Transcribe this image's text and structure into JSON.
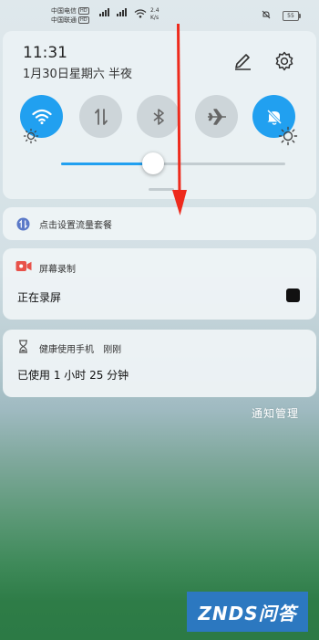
{
  "status_bar": {
    "carrier1": "中国电信",
    "carrier2": "中国联通",
    "hd_badge": "HD",
    "speed_value": "2.4",
    "speed_unit": "K/s",
    "battery": "55"
  },
  "quick_settings": {
    "time": "11:31",
    "date": "1月30日星期六 半夜",
    "toggles": [
      {
        "name": "wifi",
        "icon": "wifi-icon",
        "on": true
      },
      {
        "name": "mobile-data",
        "icon": "data-arrows-icon",
        "on": false
      },
      {
        "name": "bluetooth",
        "icon": "bluetooth-icon",
        "on": false
      },
      {
        "name": "airplane-mode",
        "icon": "airplane-icon",
        "on": false
      },
      {
        "name": "do-not-disturb",
        "icon": "bell-off-icon",
        "on": true
      }
    ],
    "brightness_level": 0.41,
    "accent_color": "#21a0f0"
  },
  "notifications": [
    {
      "title": "点击设置流量套餐",
      "icon": "data-plan-icon"
    },
    {
      "app": "屏幕录制",
      "body": "正在录屏",
      "icon": "screen-record-icon",
      "action_icon": "stop-icon"
    },
    {
      "app": "健康使用手机",
      "time": "刚刚",
      "body": "已使用 1 小时 25 分钟",
      "icon": "hourglass-icon"
    }
  ],
  "manage_label": "通知管理",
  "watermark": "ZNDS问答"
}
